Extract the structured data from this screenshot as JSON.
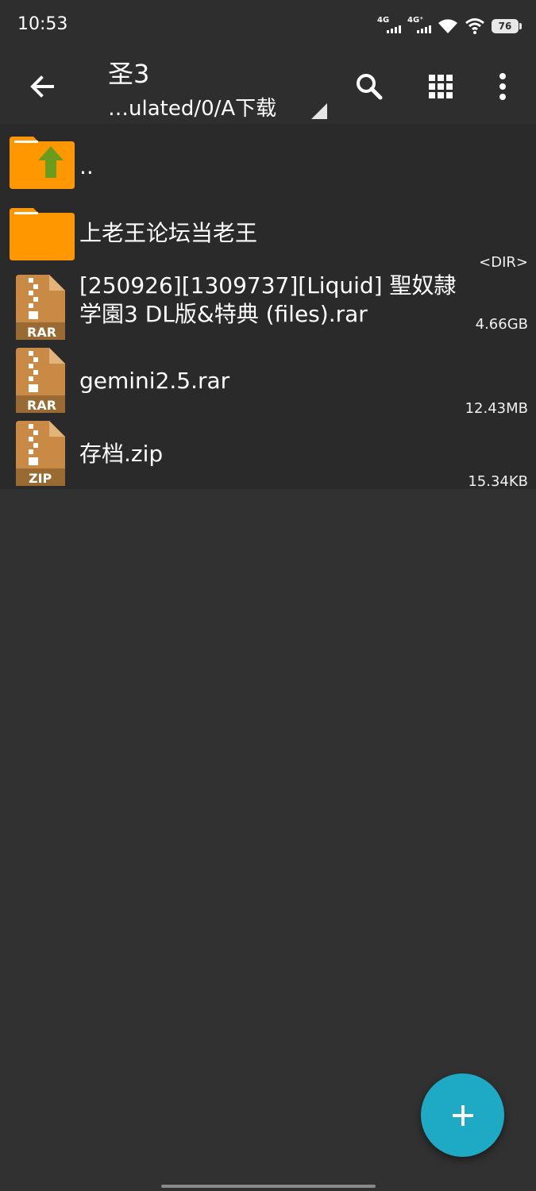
{
  "status_bar": {
    "time": "10:53",
    "sim1_label": "4G",
    "sim2_label": "4G⁺",
    "battery": "76"
  },
  "toolbar": {
    "title": "圣3",
    "path": "…ulated/0/A下载"
  },
  "files": [
    {
      "name": "..",
      "type": "parent",
      "size": ""
    },
    {
      "name": "上老王论坛当老王",
      "type": "folder",
      "size": "<DIR>"
    },
    {
      "name_line1": "[250926][1309737][Liquid] 聖奴隷",
      "name_line2": "学園3 DL版&特典 (files).rar",
      "type": "rar",
      "badge": "RAR",
      "size": "4.66GB"
    },
    {
      "name": "gemini2.5.rar",
      "type": "rar",
      "badge": "RAR",
      "size": "12.43MB"
    },
    {
      "name": "存档.zip",
      "type": "zip",
      "badge": "ZIP",
      "size": "15.34KB"
    }
  ],
  "colors": {
    "background": "#313131",
    "bar": "#2e2e2e",
    "list_background": "#2a2a2a",
    "folder_orange": "#ff9800",
    "archive_tan": "#c98a45",
    "fab": "#1ea9c4"
  },
  "icons": [
    "back-arrow-icon",
    "search-icon",
    "grid-view-icon",
    "more-vert-icon",
    "parent-folder-icon",
    "folder-icon",
    "rar-archive-icon",
    "zip-archive-icon",
    "plus-icon",
    "wifi-icon",
    "battery-icon"
  ]
}
